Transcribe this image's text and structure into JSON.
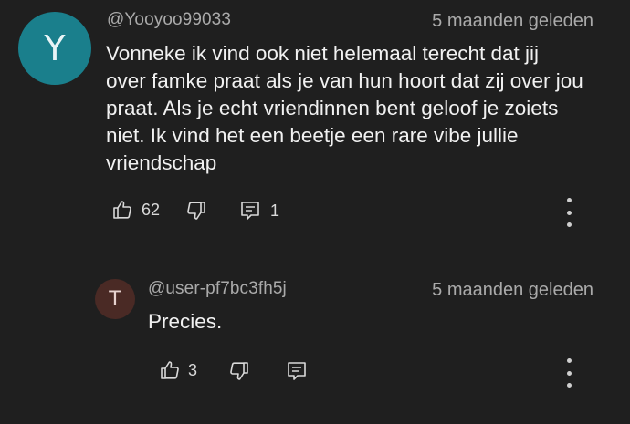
{
  "comments": [
    {
      "avatar_letter": "Y",
      "author": "@Yooyoo99033",
      "time": "5 maanden geleden",
      "lines": [
        "Vonneke ik vind ook niet helemaal terecht dat jij",
        "over famke praat als je van hun hoort dat zij over jou",
        "praat. Als je echt vriendinnen bent geloof je zoiets",
        "niet. Ik vind het een beetje een rare vibe jullie",
        "vriendschap"
      ],
      "likes": "62",
      "replies": "1"
    },
    {
      "avatar_letter": "T",
      "author": "@user-pf7bc3fh5j",
      "time": "5 maanden geleden",
      "text": "Precies.",
      "likes": "3"
    }
  ],
  "icons": {
    "like": "thumbs-up-icon",
    "dislike": "thumbs-down-icon",
    "reply": "comment-icon",
    "more": "more-vertical-icon"
  },
  "colors": {
    "background": "#1f1f1f",
    "text": "#f1f1f1",
    "muted": "#aaaaaa",
    "avatar_y": "#1a7f8c",
    "avatar_t": "#4a2a25"
  }
}
